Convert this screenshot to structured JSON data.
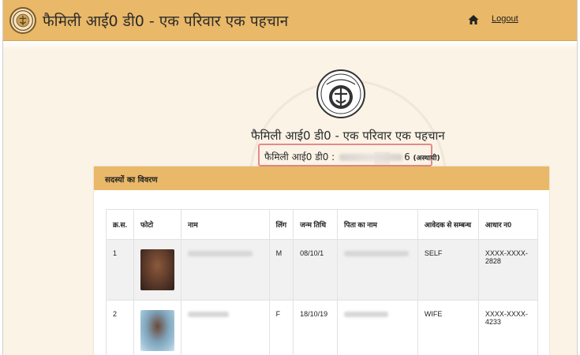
{
  "header": {
    "title": "फैमिली आई0 डी0 - एक परिवार एक पहचान",
    "logout_label": "Logout",
    "icons": [
      "emblem-logo-icon",
      "home-icon"
    ]
  },
  "main": {
    "title": "फैमिली आई0 डी0 - एक परिवार एक पहचान",
    "family_id_label": "फैमिली आई0 डी0 :",
    "family_id_suffix": "6",
    "family_id_status": "(अस्थायी)"
  },
  "members_panel": {
    "heading": "सदस्यों का विवरण",
    "columns": [
      "क्र.स.",
      "फोटो",
      "नाम",
      "लिंग",
      "जन्म तिथि",
      "पिता का नाम",
      "आवेदक से सम्बन्ध",
      "आधार न0"
    ],
    "rows": [
      {
        "sno": "1",
        "gender": "M",
        "dob": "08/10/1",
        "relation": "SELF",
        "aadhaar": "XXXX-XXXX-2828"
      },
      {
        "sno": "2",
        "gender": "F",
        "dob": "18/10/19",
        "relation": "WIFE",
        "aadhaar": "XXXX-XXXX-4233"
      }
    ]
  },
  "colors": {
    "header_bg": "#e9b868",
    "content_bg": "#fbf3e6",
    "highlight_border": "#e58a8a"
  }
}
